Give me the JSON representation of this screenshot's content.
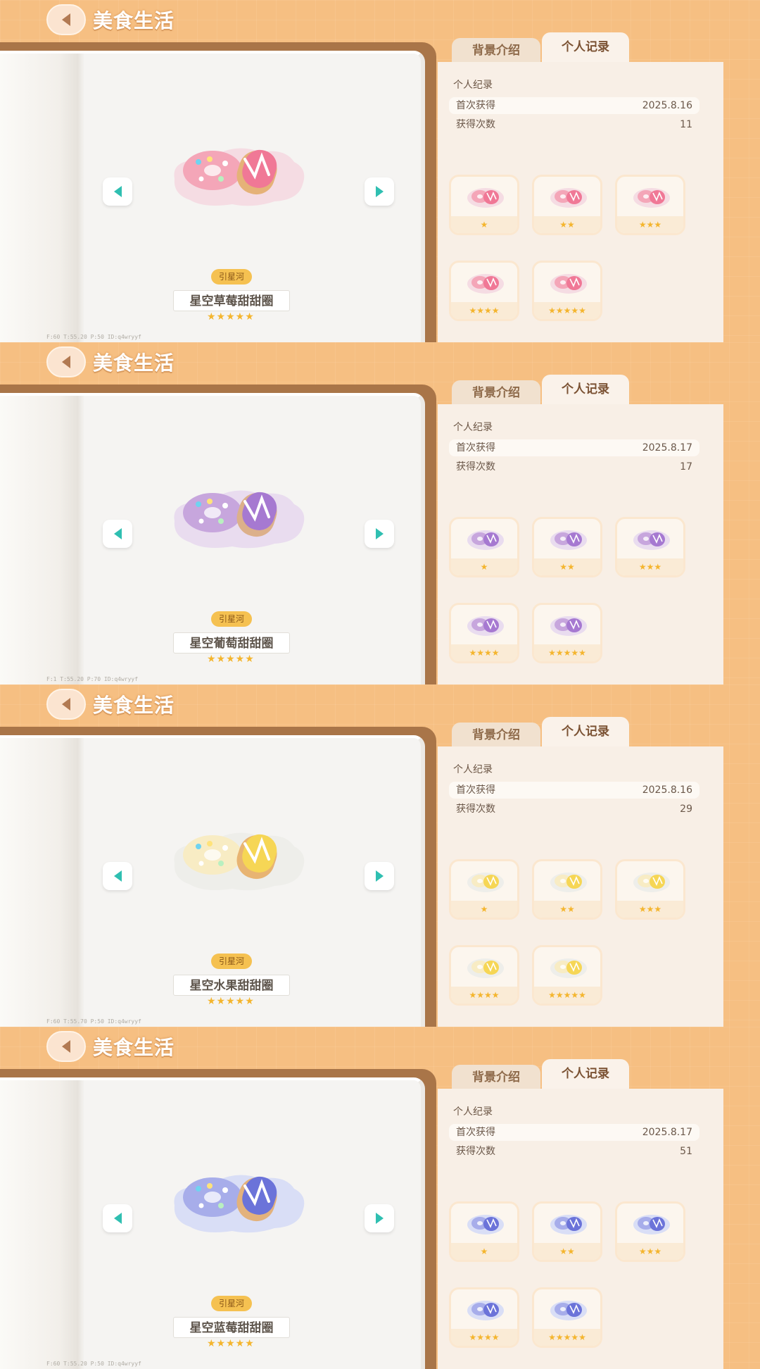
{
  "header": {
    "title": "美食生活"
  },
  "tabs": {
    "background": "背景介绍",
    "record": "个人记录"
  },
  "record_section": {
    "title": "个人纪录",
    "first_label": "首次获得",
    "count_label": "获得次数"
  },
  "item_tag": "引星河",
  "star_glyph": "★",
  "colors": {
    "accent": "#f6bf82",
    "star": "#f4b52e",
    "nav_arrow": "#2fbfb1"
  },
  "panels": [
    {
      "item_name": "星空草莓甜甜圈",
      "item_stars": "★★★★★",
      "first_obtained": "2025.8.16",
      "obtain_count": "11",
      "debug": "F:60  T:55.20  P:50  ID:q4wryyf",
      "palette": {
        "plate": "#f5dce3",
        "donut": "#f4a6b8",
        "icing": "#f07896",
        "ring": "#e5b278"
      },
      "variants": [
        "★",
        "★★",
        "★★★",
        "★★★★",
        "★★★★★"
      ]
    },
    {
      "item_name": "星空葡萄甜甜圈",
      "item_stars": "★★★★★",
      "first_obtained": "2025.8.17",
      "obtain_count": "17",
      "debug": "F:1  T:55.20  P:70  ID:q4wryyf",
      "palette": {
        "plate": "#e9dcef",
        "donut": "#c7a6dd",
        "icing": "#a679d1",
        "ring": "#dcb08a"
      },
      "variants": [
        "★",
        "★★",
        "★★★",
        "★★★★",
        "★★★★★"
      ]
    },
    {
      "item_name": "星空水果甜甜圈",
      "item_stars": "★★★★★",
      "first_obtained": "2025.8.16",
      "obtain_count": "29",
      "debug": "F:60  T:55.70  P:50  ID:q4wryyf",
      "palette": {
        "plate": "#eeeeea",
        "donut": "#f8ecc4",
        "icing": "#f6d655",
        "ring": "#e8b472"
      },
      "variants": [
        "★",
        "★★",
        "★★★",
        "★★★★",
        "★★★★★"
      ]
    },
    {
      "item_name": "星空蓝莓甜甜圈",
      "item_stars": "★★★★★",
      "first_obtained": "2025.8.17",
      "obtain_count": "51",
      "debug": "F:60  T:55.20  P:50  ID:q4wryyf",
      "palette": {
        "plate": "#d9def6",
        "donut": "#a7adea",
        "icing": "#6b73d9",
        "ring": "#e3b27c"
      },
      "variants": [
        "★",
        "★★",
        "★★★",
        "★★★★",
        "★★★★★"
      ]
    }
  ]
}
